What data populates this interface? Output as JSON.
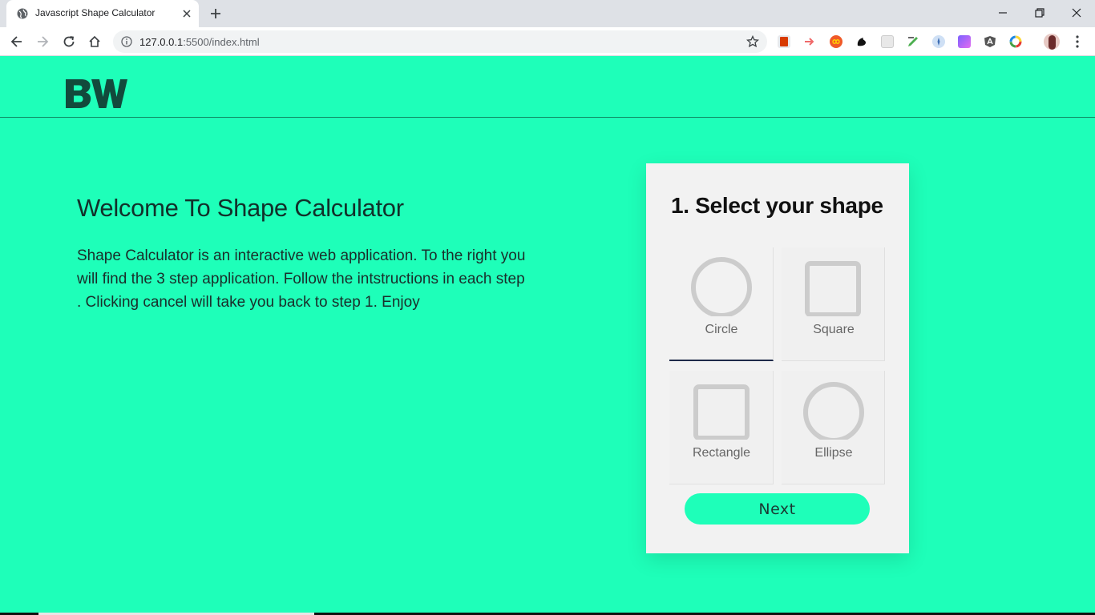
{
  "browser": {
    "tab_title": "Javascript Shape Calculator",
    "url_host": "127.0.0.1",
    "url_rest": ":5500/index.html"
  },
  "header": {
    "logo_text": "BW"
  },
  "welcome": {
    "title": "Welcome To Shape Calculator",
    "body": "Shape Calculator is an interactive web application. To the right you will find the 3 step application. Follow the intstructions in each step . Clicking cancel will take you back to step 1. Enjoy"
  },
  "calculator": {
    "step_title": "1. Select your shape",
    "selected_shape": "Circle",
    "shapes": [
      {
        "label": "Circle"
      },
      {
        "label": "Square"
      },
      {
        "label": "Rectangle"
      },
      {
        "label": "Ellipse"
      }
    ],
    "next_label": "Next"
  },
  "colors": {
    "page_background": "#1effb9",
    "card_background": "#f2f2f2",
    "shape_stroke": "#cccccc",
    "selected_underline": "#1e2a4a"
  }
}
